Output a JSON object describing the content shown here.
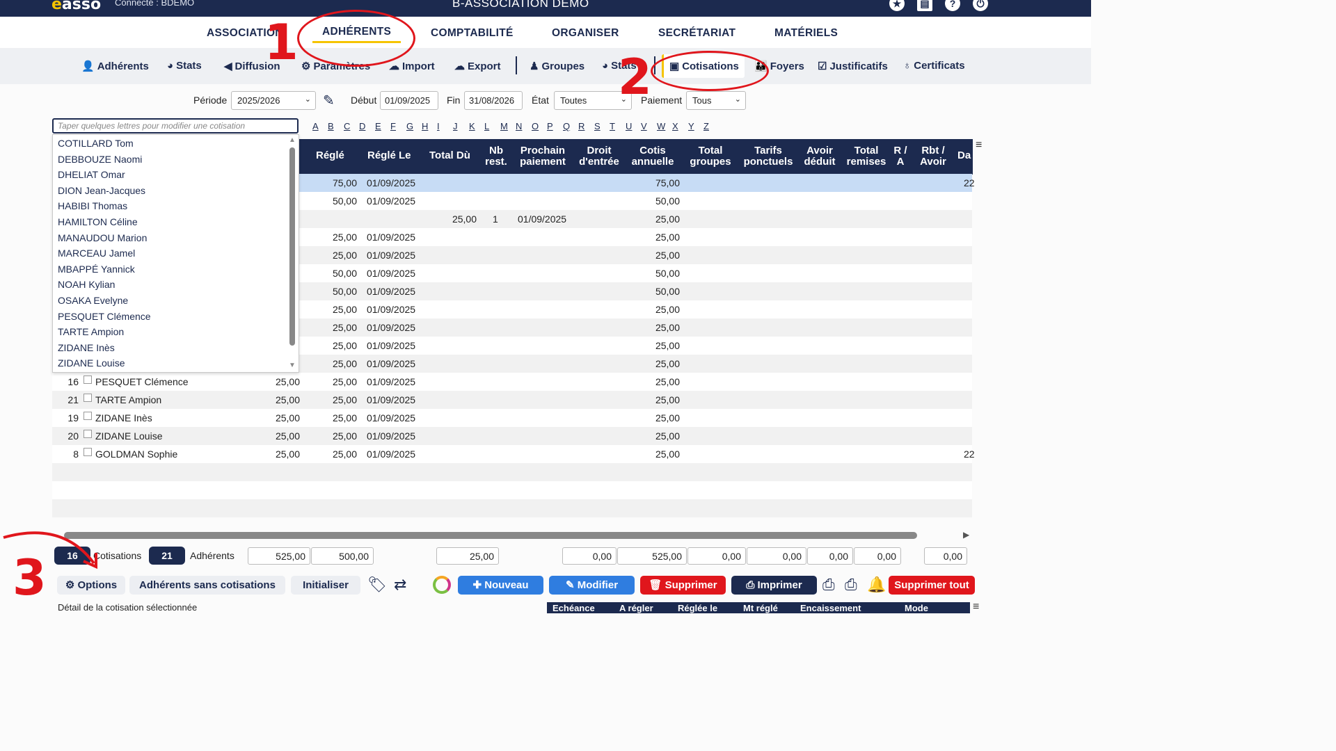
{
  "topbar": {
    "logo": "asso",
    "connected": "Connecté : BDEMO",
    "app_title": "B-ASSOCIATION DEMO",
    "icons": [
      "star-icon",
      "book-icon",
      "help-icon",
      "power-icon"
    ]
  },
  "main_nav": [
    "ASSOCIATION",
    "ADHÉRENTS",
    "COMPTABILITÉ",
    "ORGANISER",
    "SECRÉTARIAT",
    "MATÉRIELS"
  ],
  "sub_nav": [
    {
      "label": "Adhérents",
      "icon": "user-plus-icon"
    },
    {
      "label": "Stats",
      "icon": "pie-chart-icon"
    },
    {
      "label": "Diffusion",
      "icon": "megaphone-icon"
    },
    {
      "label": "Paramètres",
      "icon": "gear-icon"
    },
    {
      "label": "Import",
      "icon": "cloud-upload-icon"
    },
    {
      "label": "Export",
      "icon": "cloud-download-icon"
    },
    {
      "label": "Groupes",
      "icon": "user-tie-icon"
    },
    {
      "label": "Stats",
      "icon": "pie-chart-icon"
    },
    {
      "label": "Cotisations",
      "icon": "id-card-icon"
    },
    {
      "label": "Foyers",
      "icon": "family-icon"
    },
    {
      "label": "Justificatifs",
      "icon": "check-square-icon"
    },
    {
      "label": "Certificats",
      "icon": "stethoscope-icon"
    }
  ],
  "filters": {
    "periode_label": "Période",
    "periode_value": "2025/2026",
    "debut_label": "Début",
    "debut_value": "01/09/2025",
    "fin_label": "Fin",
    "fin_value": "31/08/2026",
    "etat_label": "État",
    "etat_value": "Toutes",
    "paiement_label": "Paiement",
    "paiement_value": "Tous"
  },
  "search": {
    "placeholder": "Taper quelques lettres pour modifier une cotisation"
  },
  "alphabet": [
    "A",
    "B",
    "C",
    "D",
    "E",
    "F",
    "G",
    "H",
    "I",
    "J",
    "K",
    "L",
    "M",
    "N",
    "O",
    "P",
    "Q",
    "R",
    "S",
    "T",
    "U",
    "V",
    "W",
    "X",
    "Y",
    "Z"
  ],
  "table": {
    "headers": [
      "Réglé",
      "Réglé Le",
      "Total Dù",
      "Nb rest.",
      "Prochain paiement",
      "Droit d'entrée",
      "Cotis annuelle",
      "Total groupes",
      "Tarifs ponctuels",
      "Avoir déduit",
      "Total remises",
      "R / A",
      "Rbt / Avoir",
      "Da"
    ],
    "top_rows": [
      {
        "regle": "75,00",
        "regle_le": "01/09/2025",
        "total_du": "",
        "nb_rest": "",
        "prochain": "",
        "cotis": "75,00",
        "extra": "22"
      },
      {
        "regle": "50,00",
        "regle_le": "01/09/2025",
        "total_du": "",
        "nb_rest": "",
        "prochain": "",
        "cotis": "50,00",
        "extra": ""
      },
      {
        "regle": "",
        "regle_le": "",
        "total_du": "25,00",
        "nb_rest": "1",
        "prochain": "01/09/2025",
        "cotis": "25,00",
        "extra": ""
      },
      {
        "regle": "25,00",
        "regle_le": "01/09/2025",
        "total_du": "",
        "nb_rest": "",
        "prochain": "",
        "cotis": "25,00",
        "extra": ""
      },
      {
        "regle": "25,00",
        "regle_le": "01/09/2025",
        "total_du": "",
        "nb_rest": "",
        "prochain": "",
        "cotis": "25,00",
        "extra": ""
      },
      {
        "regle": "50,00",
        "regle_le": "01/09/2025",
        "total_du": "",
        "nb_rest": "",
        "prochain": "",
        "cotis": "50,00",
        "extra": ""
      },
      {
        "regle": "50,00",
        "regle_le": "01/09/2025",
        "total_du": "",
        "nb_rest": "",
        "prochain": "",
        "cotis": "50,00",
        "extra": ""
      },
      {
        "regle": "25,00",
        "regle_le": "01/09/2025",
        "total_du": "",
        "nb_rest": "",
        "prochain": "",
        "cotis": "25,00",
        "extra": ""
      },
      {
        "regle": "25,00",
        "regle_le": "01/09/2025",
        "total_du": "",
        "nb_rest": "",
        "prochain": "",
        "cotis": "25,00",
        "extra": ""
      },
      {
        "regle": "25,00",
        "regle_le": "01/09/2025",
        "total_du": "",
        "nb_rest": "",
        "prochain": "",
        "cotis": "25,00",
        "extra": ""
      },
      {
        "regle": "25,00",
        "regle_le": "01/09/2025",
        "total_du": "",
        "nb_rest": "",
        "prochain": "",
        "cotis": "25,00",
        "extra": ""
      }
    ],
    "bottom_rows": [
      {
        "num": "16",
        "name": "PESQUET Clémence",
        "montant": "25,00",
        "regle": "25,00",
        "regle_le": "01/09/2025",
        "cotis": "25,00",
        "extra": ""
      },
      {
        "num": "21",
        "name": "TARTE Ampion",
        "montant": "25,00",
        "regle": "25,00",
        "regle_le": "01/09/2025",
        "cotis": "25,00",
        "extra": ""
      },
      {
        "num": "19",
        "name": "ZIDANE Inès",
        "montant": "25,00",
        "regle": "25,00",
        "regle_le": "01/09/2025",
        "cotis": "25,00",
        "extra": ""
      },
      {
        "num": "20",
        "name": "ZIDANE Louise",
        "montant": "25,00",
        "regle": "25,00",
        "regle_le": "01/09/2025",
        "cotis": "25,00",
        "extra": ""
      },
      {
        "num": "8",
        "name": "GOLDMAN Sophie",
        "montant": "25,00",
        "regle": "25,00",
        "regle_le": "01/09/2025",
        "cotis": "25,00",
        "extra": "22"
      }
    ]
  },
  "dropdown": [
    "COTILLARD Tom",
    "DEBBOUZE Naomi",
    "DHELIAT Omar",
    "DION Jean-Jacques",
    "HABIBI Thomas",
    "HAMILTON Céline",
    "MANAUDOU Marion",
    "MARCEAU Jamel",
    "MBAPPÉ Yannick",
    "NOAH Kylian",
    "OSAKA Evelyne",
    "PESQUET Clémence",
    "TARTE Ampion",
    "ZIDANE Inès",
    "ZIDANE Louise"
  ],
  "totals": {
    "cotisations_count": "16",
    "cotisations_label": "Cotisations",
    "adherents_count": "21",
    "adherents_label": "Adhérents",
    "boxes": [
      "525,00",
      "500,00",
      "25,00",
      "0,00",
      "525,00",
      "0,00",
      "0,00",
      "0,00",
      "0,00",
      "0,00"
    ]
  },
  "actions": {
    "options": "Options",
    "sans_cotisations": "Adhérents sans cotisations",
    "initialiser": "Initialiser",
    "nouveau": "Nouveau",
    "modifier": "Modifier",
    "supprimer": "Supprimer",
    "imprimer": "Imprimer",
    "supprimer_tout": "Supprimer tout"
  },
  "detail": {
    "label": "Détail de la cotisation sélectionnée",
    "headers": [
      "Echéance",
      "A régler",
      "Réglée le",
      "Mt réglé",
      "Encaissement",
      "Mode"
    ]
  },
  "annotations": [
    "1",
    "2",
    "3"
  ],
  "colors": {
    "navy": "#1c2a4f",
    "accent": "#f5c400",
    "red": "#e0161c",
    "blue": "#2f7de0"
  }
}
